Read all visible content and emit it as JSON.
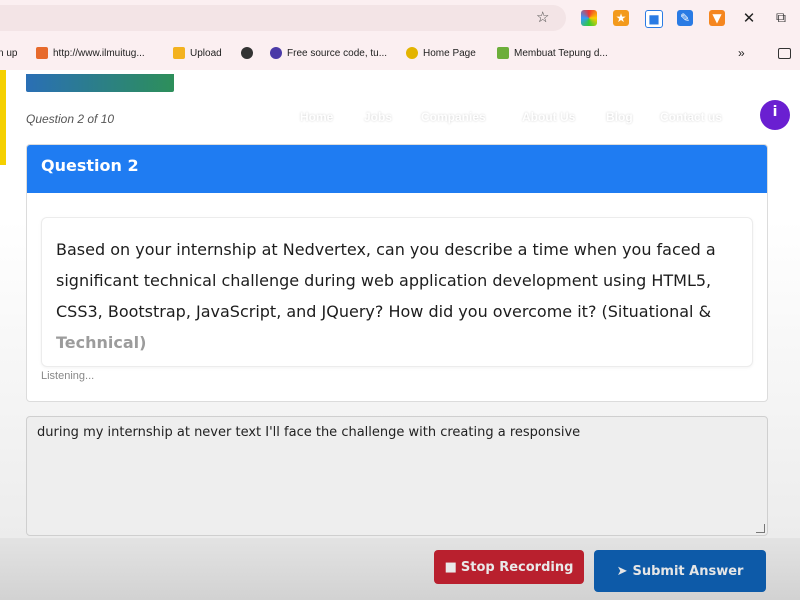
{
  "browser": {
    "bookmarks": [
      {
        "label": "n up"
      },
      {
        "label": "http://www.ilmuitug..."
      },
      {
        "label": "Upload"
      },
      {
        "label": ""
      },
      {
        "label": "Free source code, tu..."
      },
      {
        "label": "Home Page"
      },
      {
        "label": "Membuat Tepung d..."
      }
    ],
    "more_label": "»"
  },
  "page": {
    "question_counter": "Question 2 of 10",
    "nav": [
      "Home",
      "Jobs",
      "Companies",
      "About Us",
      "Blog",
      "Contact us"
    ],
    "progress_fraction": 0.2
  },
  "question": {
    "title": "Question 2",
    "text_main": "Based on your internship at Nedvertex, can you describe a time when you faced a significant technical challenge during web application development using HTML5, CSS3, Bootstrap, JavaScript, and JQuery? How did you overcome it? (Situational & ",
    "text_highlight": "Technical)",
    "status": "Listening..."
  },
  "answer": {
    "value": "during my internship at never text I'll face the challenge with creating a responsive"
  },
  "buttons": {
    "stop": "Stop Recording",
    "submit": "Submit Answer"
  },
  "colors": {
    "header_blue": "#1f7cf2",
    "stop_red": "#b9202e",
    "submit_blue": "#0d5aa8",
    "info_purple": "#6a1fd1"
  }
}
